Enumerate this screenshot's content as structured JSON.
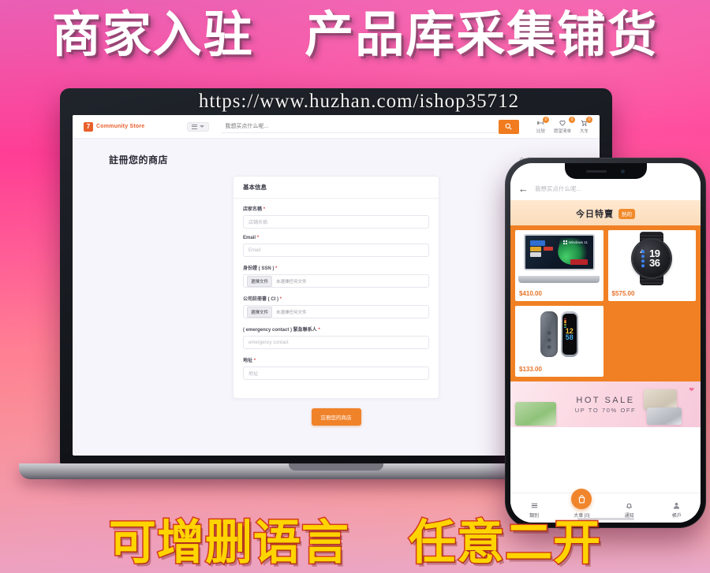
{
  "promo": {
    "headline_left": "商家入驻",
    "headline_right": "产品库采集铺货",
    "footer_left": "可增删语言",
    "footer_right": "任意二开",
    "url": "https://www.huzhan.com/ishop35712",
    "accent_orange": "#f0822a",
    "bg_top": "#ff3d95",
    "bg_bottom": "#f0a6b4",
    "footer_text_color": "#ffd400",
    "footer_stroke_color": "#d23c1e"
  },
  "desktop": {
    "header": {
      "brand_mark": "7",
      "brand_name": "Community Store",
      "category_label": "menu-icon",
      "search_placeholder": "我想买点什么呢...",
      "search_icon": "search-icon",
      "icons": [
        {
          "name": "compare-icon",
          "label": "比较",
          "badge": "0"
        },
        {
          "name": "wishlist-icon",
          "label": "愿望清单",
          "badge": "0"
        },
        {
          "name": "cart-icon",
          "label": "大车",
          "badge": "0"
        }
      ]
    },
    "page_title": "註冊您的商店",
    "breadcrumb": {
      "home_icon": "home-icon",
      "separator": "/",
      "current": "註冊您的商店"
    },
    "form": {
      "card_title": "基本信息",
      "required_mark": "*",
      "fields": [
        {
          "label": "店家名稱",
          "placeholder": "店鋪名稱",
          "type": "text",
          "required": true
        },
        {
          "label": "Email",
          "placeholder": "Email",
          "type": "text",
          "required": true
        },
        {
          "label": "身份證 ( SSN )",
          "type": "file",
          "required": true,
          "button": "選擇文件",
          "status": "未選擇任何文件"
        },
        {
          "label": "公司註冊書 ( CI )",
          "type": "file",
          "required": true,
          "button": "選擇文件",
          "status": "未選擇任何文件"
        },
        {
          "label": "( emergency contact ) 緊急聯系人",
          "placeholder": "emergency contact",
          "type": "text",
          "required": true
        },
        {
          "label": "地址",
          "placeholder": "地址",
          "type": "text",
          "required": true
        }
      ],
      "submit_label": "註冊您的商店"
    }
  },
  "mobile": {
    "back_icon": "back-arrow-icon",
    "search_placeholder": "我想买点什么呢...",
    "deals": {
      "title": "今日特賣",
      "badge": "熱的",
      "products": [
        {
          "name": "laptop",
          "price": "$410.00",
          "screen_label": "Windows 11"
        },
        {
          "name": "smartwatch",
          "price": "$575.00",
          "time_hour": "19",
          "time_min": "36"
        },
        {
          "name": "fitness-band",
          "price": "$133.00",
          "time_hour": "12",
          "time_min": "58"
        }
      ]
    },
    "hot_banner": {
      "line1": "HOT SALE",
      "line2": "UP TO 70% OFF"
    },
    "nav": [
      {
        "icon": "categories-icon",
        "label": "類別"
      },
      {
        "icon": "cart-icon",
        "label": "大車 [0]"
      },
      {
        "icon": "bell-icon",
        "label": "通知"
      },
      {
        "icon": "account-icon",
        "label": "帳戶"
      }
    ]
  }
}
